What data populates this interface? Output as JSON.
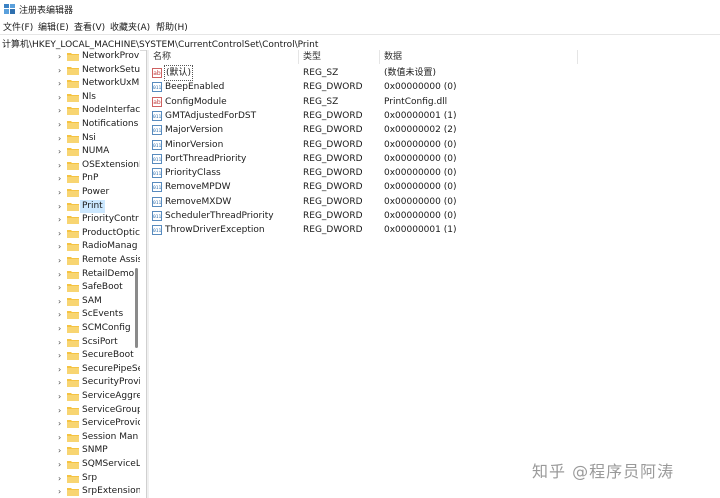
{
  "window": {
    "title": "注册表编辑器",
    "icon": "regedit-icon"
  },
  "menu": [
    {
      "label": "文件(F)"
    },
    {
      "label": "编辑(E)"
    },
    {
      "label": "查看(V)"
    },
    {
      "label": "收藏夹(A)"
    },
    {
      "label": "帮助(H)"
    }
  ],
  "address": {
    "path": "计算机\\HKEY_LOCAL_MACHINE\\SYSTEM\\CurrentControlSet\\Control\\Print"
  },
  "tree": {
    "folder_color": "#f5c342",
    "selected_label": "Print",
    "items": [
      {
        "label": "NetworkProv"
      },
      {
        "label": "NetworkSetu"
      },
      {
        "label": "NetworkUxM"
      },
      {
        "label": "Nls"
      },
      {
        "label": "NodeInterfac"
      },
      {
        "label": "Notifications"
      },
      {
        "label": "Nsi"
      },
      {
        "label": "NUMA"
      },
      {
        "label": "OSExtensionI"
      },
      {
        "label": "PnP"
      },
      {
        "label": "Power"
      },
      {
        "label": "Print"
      },
      {
        "label": "PriorityContr"
      },
      {
        "label": "ProductOptic"
      },
      {
        "label": "RadioManag"
      },
      {
        "label": "Remote Assis"
      },
      {
        "label": "RetailDemo"
      },
      {
        "label": "SafeBoot"
      },
      {
        "label": "SAM"
      },
      {
        "label": "ScEvents"
      },
      {
        "label": "SCMConfig"
      },
      {
        "label": "ScsiPort"
      },
      {
        "label": "SecureBoot"
      },
      {
        "label": "SecurePipeSe"
      },
      {
        "label": "SecurityProvi"
      },
      {
        "label": "ServiceAggre"
      },
      {
        "label": "ServiceGroup"
      },
      {
        "label": "ServiceProvic"
      },
      {
        "label": "Session Man"
      },
      {
        "label": "SNMP"
      },
      {
        "label": "SQMServiceL"
      },
      {
        "label": "Srp"
      },
      {
        "label": "SrpExtension"
      }
    ]
  },
  "columns": {
    "name": "名称",
    "type": "类型",
    "data": "数据"
  },
  "values": [
    {
      "name": "(默认)",
      "type": "REG_SZ",
      "data": "(数值未设置)",
      "icon": "string-value-icon"
    },
    {
      "name": "BeepEnabled",
      "type": "REG_DWORD",
      "data": "0x00000000 (0)",
      "icon": "binary-value-icon"
    },
    {
      "name": "ConfigModule",
      "type": "REG_SZ",
      "data": "PrintConfig.dll",
      "icon": "string-value-icon"
    },
    {
      "name": "GMTAdjustedForDST",
      "type": "REG_DWORD",
      "data": "0x00000001 (1)",
      "icon": "binary-value-icon"
    },
    {
      "name": "MajorVersion",
      "type": "REG_DWORD",
      "data": "0x00000002 (2)",
      "icon": "binary-value-icon"
    },
    {
      "name": "MinorVersion",
      "type": "REG_DWORD",
      "data": "0x00000000 (0)",
      "icon": "binary-value-icon"
    },
    {
      "name": "PortThreadPriority",
      "type": "REG_DWORD",
      "data": "0x00000000 (0)",
      "icon": "binary-value-icon"
    },
    {
      "name": "PriorityClass",
      "type": "REG_DWORD",
      "data": "0x00000000 (0)",
      "icon": "binary-value-icon"
    },
    {
      "name": "RemoveMPDW",
      "type": "REG_DWORD",
      "data": "0x00000000 (0)",
      "icon": "binary-value-icon"
    },
    {
      "name": "RemoveMXDW",
      "type": "REG_DWORD",
      "data": "0x00000000 (0)",
      "icon": "binary-value-icon"
    },
    {
      "name": "SchedulerThreadPriority",
      "type": "REG_DWORD",
      "data": "0x00000000 (0)",
      "icon": "binary-value-icon"
    },
    {
      "name": "ThrowDriverException",
      "type": "REG_DWORD",
      "data": "0x00000001 (1)",
      "icon": "binary-value-icon"
    }
  ],
  "watermark": {
    "text": "知乎 @程序员阿涛"
  }
}
